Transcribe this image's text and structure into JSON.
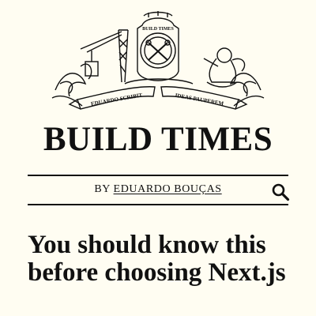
{
  "header": {
    "crest": {
      "ribbon_left": "EDUARDO SCRIBIT",
      "ribbon_right": "IDEAS PAUPEREM",
      "badge_text": "BUILD TIMES"
    },
    "site_title": "BUILD TIMES",
    "byline_prefix": "BY ",
    "author_name": "EDUARDO BOUÇAS",
    "search_icon": "search-icon"
  },
  "post": {
    "title": "You should know this before choosing Next.js"
  },
  "colors": {
    "background": "#fffdf2",
    "text": "#111111"
  }
}
